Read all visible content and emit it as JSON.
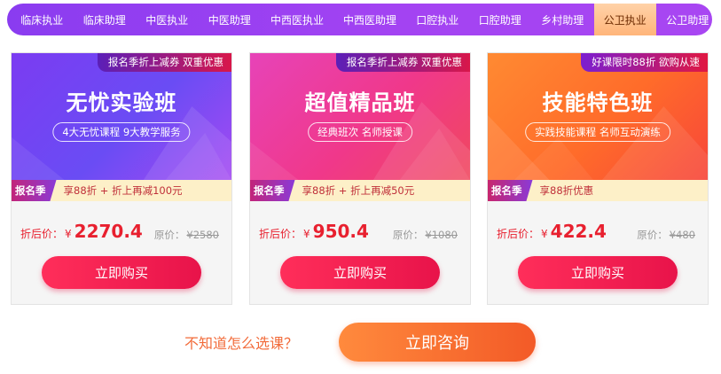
{
  "nav": {
    "tabs": [
      {
        "label": "临床执业"
      },
      {
        "label": "临床助理"
      },
      {
        "label": "中医执业"
      },
      {
        "label": "中医助理"
      },
      {
        "label": "中西医执业"
      },
      {
        "label": "中西医助理"
      },
      {
        "label": "口腔执业"
      },
      {
        "label": "口腔助理"
      },
      {
        "label": "乡村助理"
      },
      {
        "label": "公卫执业"
      },
      {
        "label": "公卫助理"
      }
    ],
    "active_tab": "公卫执业"
  },
  "cards": [
    {
      "ribbon": "报名季折上减券 双重优惠",
      "title": "无忧实验班",
      "subtitle": "4大无忧课程 9大教学服务",
      "promo_badge": "报名季",
      "promo_text": "享88折 + 折上再减100元",
      "price_label": "折后价：",
      "currency": "¥",
      "price": "2270.4",
      "orig_label": "原价：",
      "orig_price": "¥2580",
      "buy_label": "立即购买"
    },
    {
      "ribbon": "报名季折上减券 双重优惠",
      "title": "超值精品班",
      "subtitle": "经典班次 名师授课",
      "promo_badge": "报名季",
      "promo_text": "享88折 + 折上再减50元",
      "price_label": "折后价：",
      "currency": "¥",
      "price": "950.4",
      "orig_label": "原价：",
      "orig_price": "¥1080",
      "buy_label": "立即购买"
    },
    {
      "ribbon": "好课限时88折 欲购从速",
      "title": "技能特色班",
      "subtitle": "实践技能课程 名师互动演练",
      "promo_badge": "报名季",
      "promo_text": "享88折优惠",
      "price_label": "折后价：",
      "currency": "¥",
      "price": "422.4",
      "orig_label": "原价：",
      "orig_price": "¥480",
      "buy_label": "立即购买"
    }
  ],
  "footer": {
    "question": "不知道怎么选课？",
    "consult_label": "立即咨询"
  },
  "colors": {
    "nav_purple": "#a343f2",
    "active_tab": "#ffb57a",
    "price_red": "#e8202f",
    "buy_button": "#ee1c4e",
    "consult_orange": "#f5692b",
    "question_text": "#f26b3a"
  }
}
